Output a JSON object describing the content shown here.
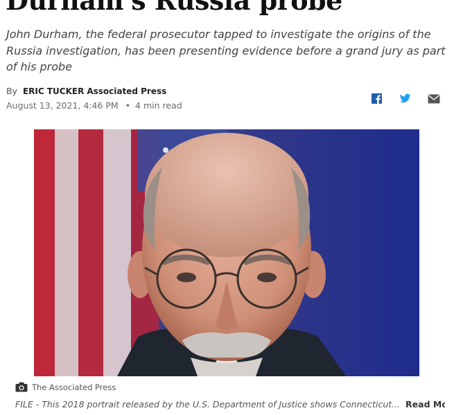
{
  "article": {
    "headline": "Durham's Russia probe",
    "subhead": "John Durham, the federal prosecutor tapped to investigate the origins of the Russia investigation, has been presenting evidence before a grand jury as part of his probe",
    "byline_prefix": "By",
    "author": "ERIC TUCKER",
    "organization": "Associated Press",
    "date": "August 13, 2021, 4:46 PM",
    "separator": "•",
    "read_time": "4 min read"
  },
  "share": {
    "icons": [
      "facebook-icon",
      "twitter-icon",
      "email-icon"
    ],
    "colors": {
      "facebook": "#1f5ea8",
      "twitter": "#1da1f2",
      "email": "#555555"
    }
  },
  "photo": {
    "credit": "The Associated Press",
    "caption": "FILE - This 2018 portrait released by the U.S. Department of Justice shows Connecticut...",
    "read_more": "Read More"
  }
}
